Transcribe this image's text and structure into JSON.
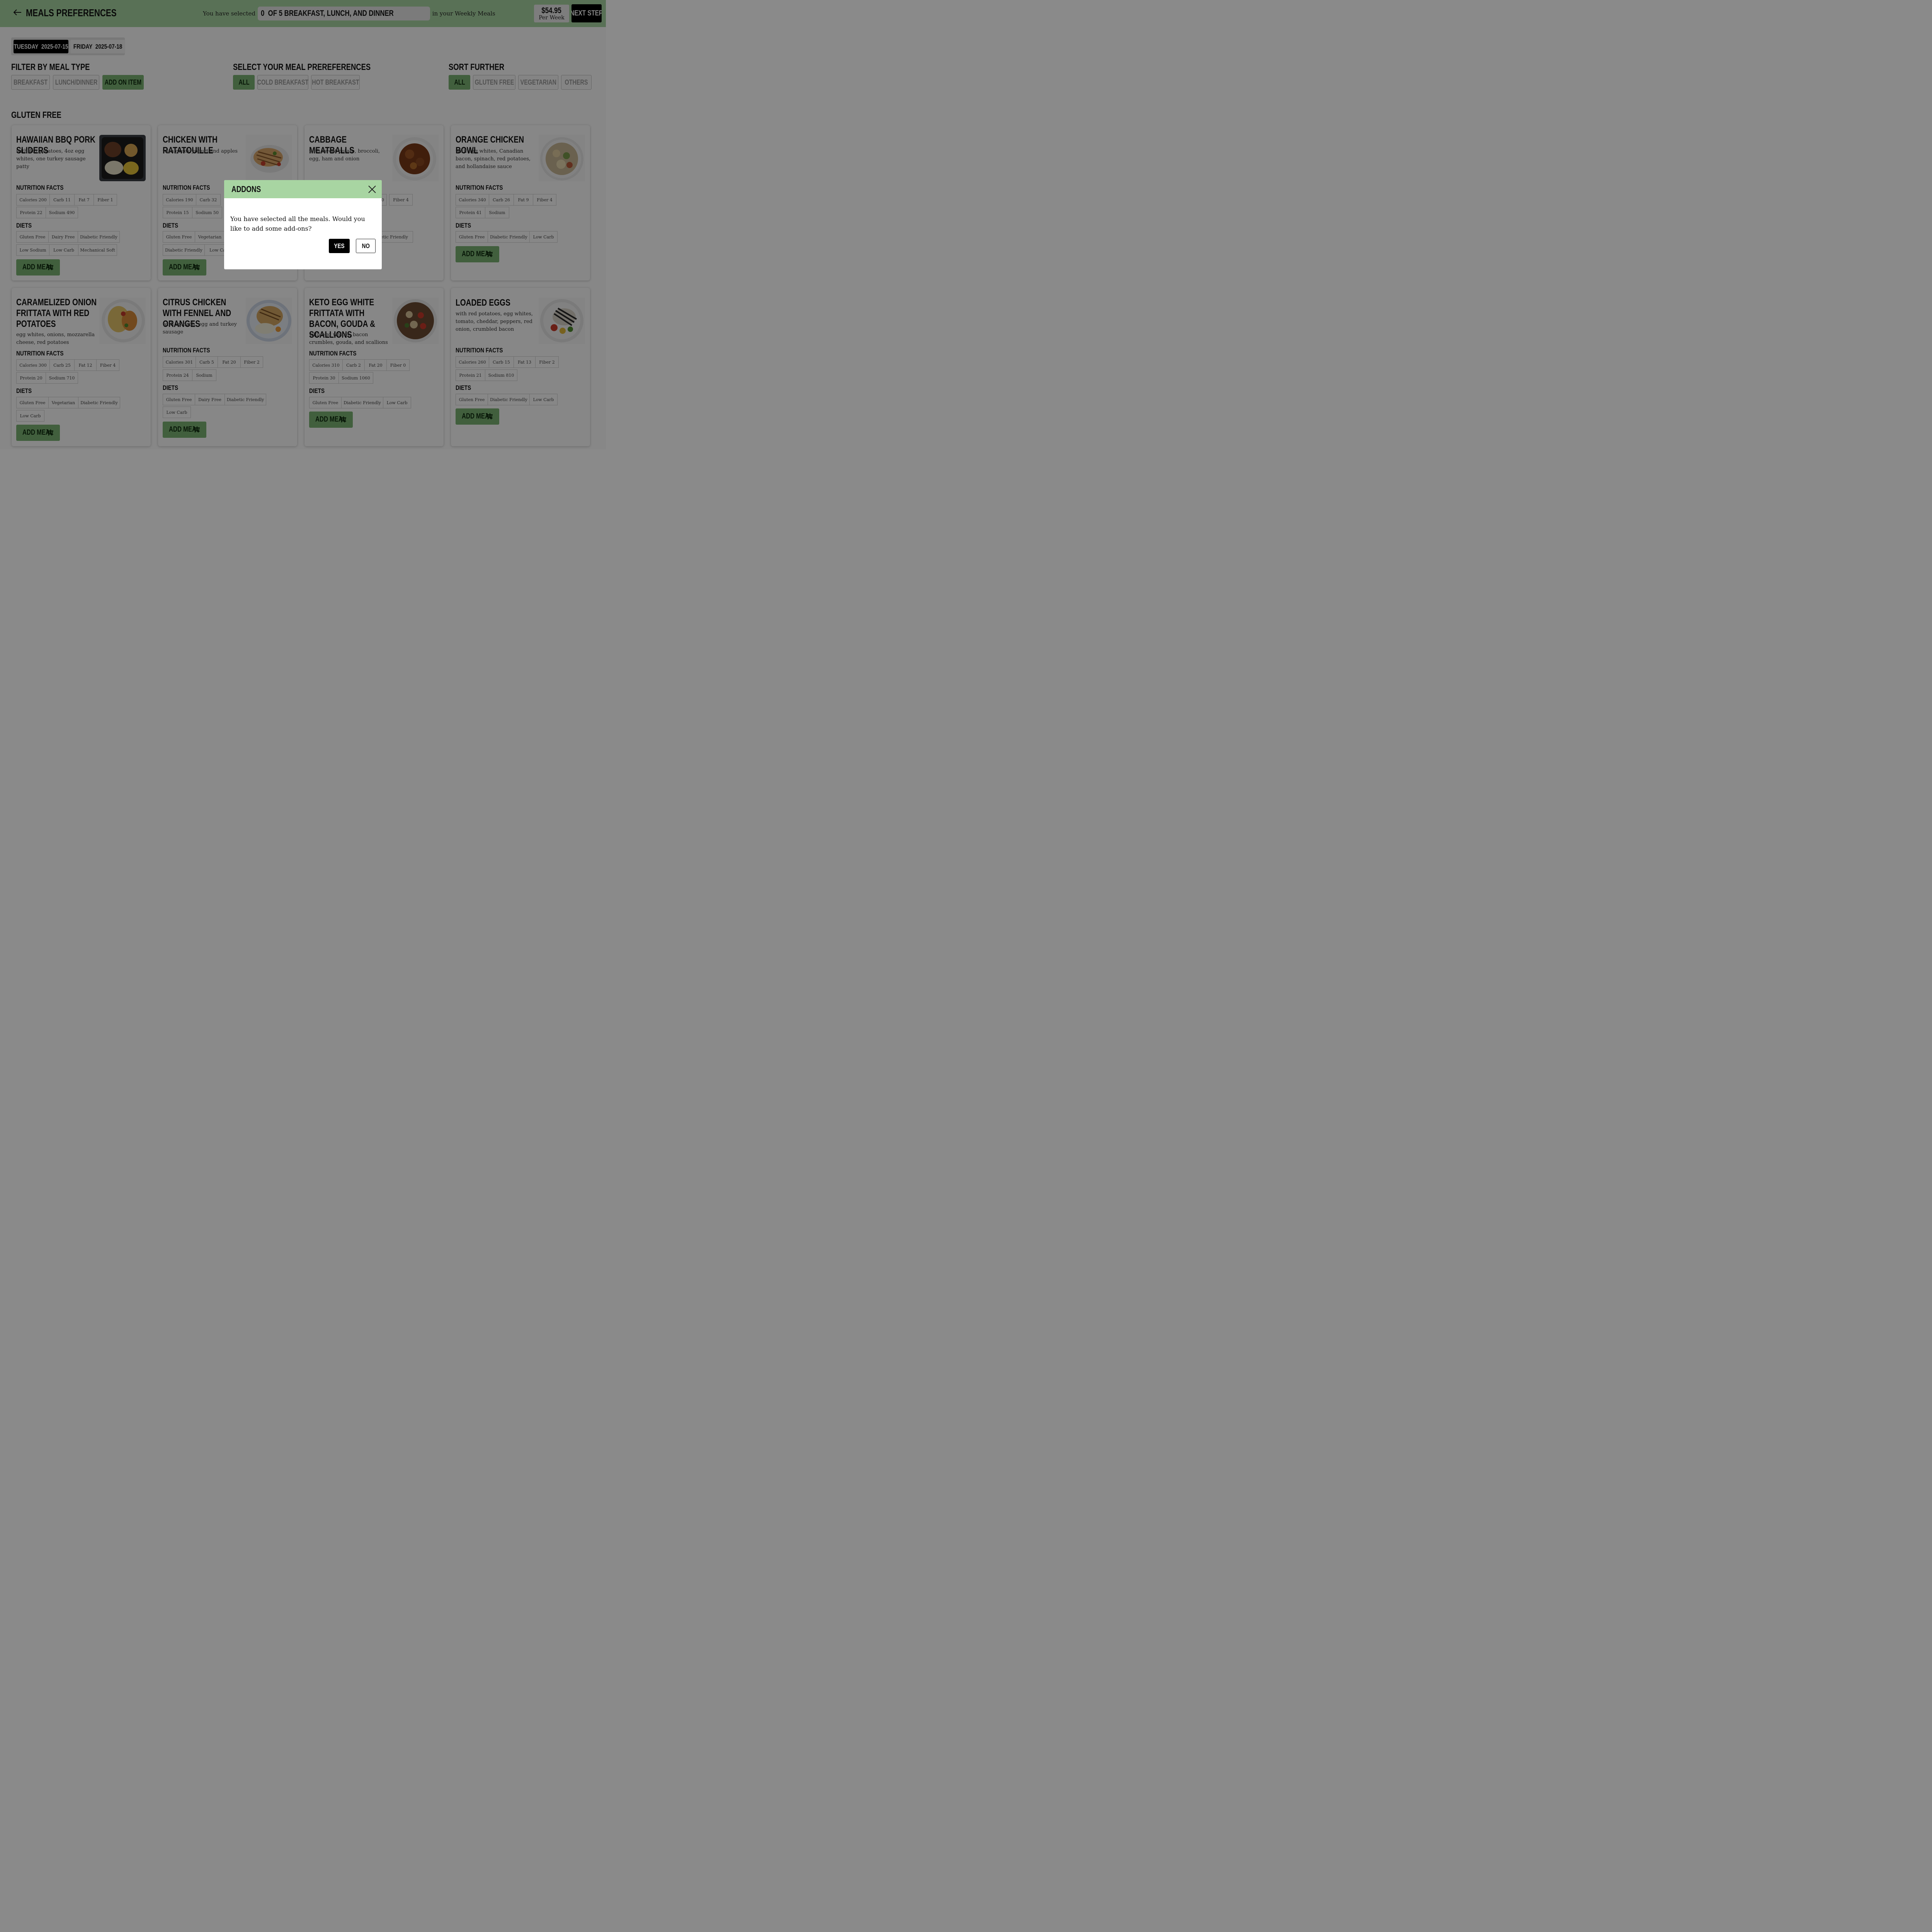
{
  "header": {
    "title": "MEALS PREFERENCES",
    "selection_prefix": "You have selected",
    "selection_badge": "0  OF 5 BREAKFAST, LUNCH, AND DINNER",
    "selection_suffix": "in your Weekly Meals",
    "price": "$54.95",
    "price_period": "Per Week",
    "next_label": "NEXT STEP"
  },
  "date_tabs": [
    {
      "day": "TUESDAY",
      "date": "2025-07-15",
      "active": true
    },
    {
      "day": "FRIDAY",
      "date": "2025-07-18",
      "active": false
    }
  ],
  "filters": {
    "meal_type": {
      "heading": "FILTER BY MEAL TYPE",
      "options": [
        "BREAKFAST",
        "LUNCH/DINNER",
        "ADD ON ITEM"
      ],
      "selected": "ADD ON ITEM"
    },
    "preferences": {
      "heading": "SELECT YOUR MEAL PREREFERENCES",
      "options": [
        "ALL",
        "COLD BREAKFAST",
        "HOT BREAKFAST"
      ],
      "selected": "ALL"
    },
    "sort": {
      "heading": "SORT FURTHER",
      "options": [
        "ALL",
        "GLUTEN FREE",
        "VEGETARIAN",
        "OTHERS"
      ],
      "selected": "ALL"
    }
  },
  "section_heading": "GLUTEN FREE",
  "labels": {
    "nutrition": "NUTRITION FACTS",
    "diets": "DIETS",
    "add_meal": "ADD MEAL"
  },
  "meals": [
    {
      "title": "HAWAIIAN BBQ PORK SLIDERS",
      "desc": "with 4oz potatoes, 4oz egg whites, one turkey sausage patty",
      "nutrition": [
        "Calories 200",
        "Carb 11",
        "Fat 7",
        "Fiber 1",
        "Protein 22",
        "Sodium 490"
      ],
      "diets": [
        "Gluten Free",
        "Dairy Free",
        "Diabetic Friendly",
        "Low Sodium",
        "Low Carb",
        "Mechanical Soft"
      ]
    },
    {
      "title": "CHICKEN WITH RATATOUILLE",
      "desc": "with greek yogurt and apples",
      "nutrition": [
        "Calories 190",
        "Carb 32",
        "",
        "",
        "Protein 15",
        "Sodium 50"
      ],
      "diets": [
        "Gluten Free",
        "Vegetarian",
        "",
        "Diabetic Friendly",
        "Low Ca"
      ]
    },
    {
      "title": "CABBAGE MEATBALLS",
      "desc": "with sweet potato, broccoli, egg, ham and onion",
      "nutrition": [
        "0",
        "Fiber 4"
      ],
      "diets": [
        "betic Friendly"
      ]
    },
    {
      "title": "ORANGE CHICKEN BOWL",
      "desc": "with egg whites, Canadian bacon, spinach, red potatoes, and hollandaise sauce",
      "nutrition": [
        "Calories 340",
        "Carb 26",
        "Fat 9",
        "Fiber 4",
        "Protein 41",
        "Sodium"
      ],
      "diets": [
        "Gluten Free",
        "Diabetic Friendly",
        "Low Carb"
      ]
    },
    {
      "title": "CARAMELIZED ONION FRITTATA WITH RED POTATOES",
      "desc": "egg whites, onions, mozzarella cheese, red potatoes",
      "nutrition": [
        "Calories 300",
        "Carb 25",
        "Fat 12",
        "Fiber 4",
        "Protein 20",
        "Sodium 710"
      ],
      "diets": [
        "Gluten Free",
        "Vegetarian",
        "Diabetic Friendly",
        "Low Carb"
      ]
    },
    {
      "title": "CITRUS CHICKEN WITH FENNEL AND ORANGES",
      "desc": "with spinach, egg and turkey sausage",
      "nutrition": [
        "Calories 301",
        "Carb 5",
        "Fat 20",
        "Fiber 2",
        "Protein 24",
        "Sodium"
      ],
      "diets": [
        "Gluten Free",
        "Dairy Free",
        "Diabetic Friendly",
        "Low Carb"
      ]
    },
    {
      "title": "KETO EGG WHITE FRITTATA WITH BACON, GOUDA & SCALLIONS",
      "desc": "with egg whites, bacon crumbles, gouda, and scallions",
      "nutrition": [
        "Calories 310",
        "Carb 2",
        "Fat 20",
        "Fiber 0",
        "Protein 30",
        "Sodium 1060"
      ],
      "diets": [
        "Gluten Free",
        "Diabetic Friendly",
        "Low Carb"
      ]
    },
    {
      "title": "LOADED EGGS",
      "desc": "with red potatoes, egg whites, tomato, cheddar, peppers, red onion, crumbled bacon",
      "nutrition": [
        "Calories 260",
        "Carb 15",
        "Fat 13",
        "Fiber 2",
        "Protein 21",
        "Sodium 810"
      ],
      "diets": [
        "Gluten Free",
        "Diabetic Friendly",
        "Low Carb"
      ]
    }
  ],
  "modal": {
    "title": "ADDONS",
    "message": "You have selected all the meals. Would you like to add some add-ons?",
    "yes_label": "YES",
    "no_label": "NO"
  },
  "icons": [
    "back-arrow-icon",
    "cart-icon",
    "close-icon"
  ],
  "colors": {
    "accent_green": "#a8d5a2",
    "button_green": "#7bb374",
    "dark": "#000000"
  }
}
